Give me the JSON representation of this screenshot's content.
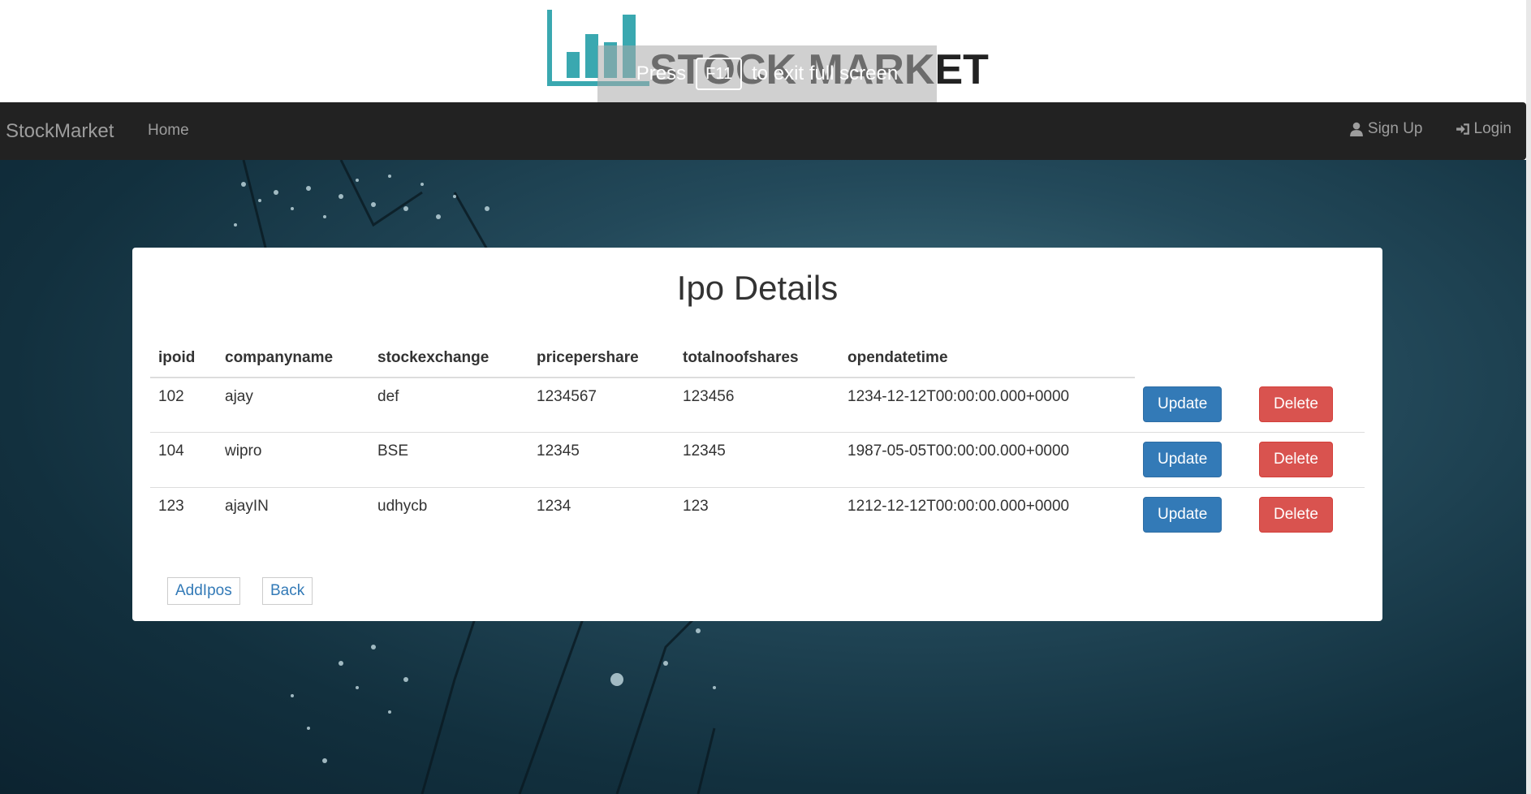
{
  "logo": {
    "text": "STOCK MARKET",
    "fullscreen_hint_prefix": "Press",
    "fullscreen_key": "F11",
    "fullscreen_hint_suffix": "to exit full screen",
    "icon": "bar-chart-logo",
    "color": "#3aa8b0"
  },
  "navbar": {
    "brand": "StockMarket",
    "home": "Home",
    "signup": "Sign Up",
    "login": "Login",
    "signup_icon": "user-icon",
    "login_icon": "login-icon"
  },
  "page": {
    "title": "Ipo Details"
  },
  "table": {
    "headers": [
      "ipoid",
      "companyname",
      "stockexchange",
      "pricepershare",
      "totalnoofshares",
      "opendatetime"
    ],
    "rows": [
      {
        "ipoid": "102",
        "companyname": "ajay",
        "stockexchange": "def",
        "pricepershare": "1234567",
        "totalnoofshares": "123456",
        "opendatetime": "1234-12-12T00:00:00.000+0000"
      },
      {
        "ipoid": "104",
        "companyname": "wipro",
        "stockexchange": "BSE",
        "pricepershare": "12345",
        "totalnoofshares": "12345",
        "opendatetime": "1987-05-05T00:00:00.000+0000"
      },
      {
        "ipoid": "123",
        "companyname": "ajayIN",
        "stockexchange": "udhycb",
        "pricepershare": "1234",
        "totalnoofshares": "123",
        "opendatetime": "1212-12-12T00:00:00.000+0000"
      }
    ],
    "update_label": "Update",
    "delete_label": "Delete"
  },
  "actions": {
    "add": "AddIpos",
    "back": "Back"
  },
  "colors": {
    "primary": "#337ab7",
    "danger": "#d9534f",
    "navbar": "#222222"
  }
}
